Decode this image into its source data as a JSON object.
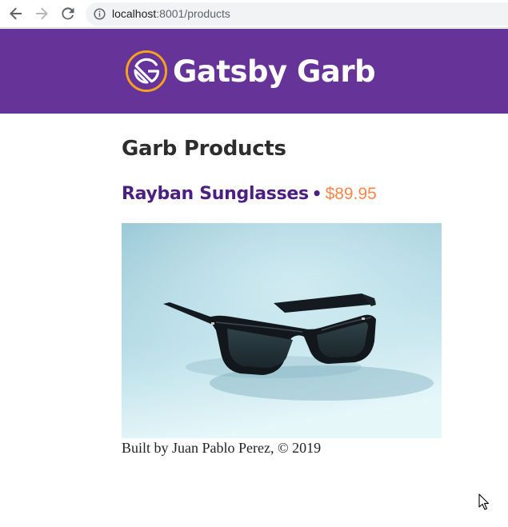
{
  "browser": {
    "url_host": "localhost",
    "url_rest": ":8001/products",
    "icons": {
      "back": "arrow-left-icon",
      "forward": "arrow-right-icon",
      "reload": "reload-icon",
      "info": "info-icon"
    }
  },
  "site": {
    "title": "Gatsby Garb",
    "logo_icon": "gatsby-logo-icon",
    "header_color": "#663399",
    "accent_color": "#f6874c"
  },
  "main": {
    "page_title": "Garb Products",
    "products": [
      {
        "name": "Rayban Sunglasses",
        "separator": "•",
        "price": "$89.95",
        "image_icon": "sunglasses-photo"
      }
    ]
  },
  "footer": {
    "text": "Built by Juan Pablo Perez, © 2019"
  }
}
